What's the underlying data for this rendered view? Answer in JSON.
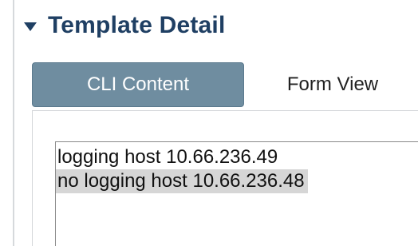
{
  "section": {
    "title": "Template Detail"
  },
  "tabs": [
    {
      "label": "CLI Content",
      "active": true
    },
    {
      "label": "Form View",
      "active": false
    }
  ],
  "cli": {
    "lines": [
      {
        "text": "logging host 10.66.236.49",
        "selected": false
      },
      {
        "text": "no logging host 10.66.236.48",
        "selected": true
      }
    ]
  },
  "colors": {
    "title": "#1f3f63",
    "active_tab_bg": "#6f8da0",
    "selection_bg": "#d6d6d6"
  }
}
